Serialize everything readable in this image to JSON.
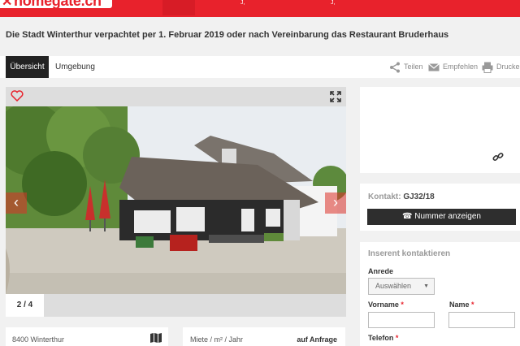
{
  "header": {
    "logo_text": "homegate.ch",
    "nav_mark": "J,"
  },
  "listing": {
    "title": "Die Stadt Winterthur verpachtet per 1. Februar 2019 oder nach Vereinbarung das Restaurant Bruderhaus"
  },
  "tabs": [
    {
      "label": "Übersicht"
    },
    {
      "label": "Umgebung"
    }
  ],
  "actions": {
    "share": "Teilen",
    "recommend": "Empfehlen",
    "print": "Drucken"
  },
  "gallery": {
    "counter": "2 / 4",
    "prev_glyph": "‹",
    "next_glyph": "›"
  },
  "info": {
    "location": "8400 Winterthur",
    "rent_label": "Miete / m² / Jahr",
    "rent_value": "auf Anfrage"
  },
  "contact": {
    "label": "Kontakt:",
    "code": "GJ32/18",
    "phone_button": "Nummer anzeigen"
  },
  "form": {
    "title": "Inserent kontaktieren",
    "salutation_label": "Anrede",
    "salutation_value": "Auswählen",
    "firstname_label": "Vorname",
    "lastname_label": "Name",
    "phone_label": "Telefon",
    "required_mark": "*"
  },
  "colors": {
    "brand": "#e8222c",
    "dark": "#222222"
  }
}
